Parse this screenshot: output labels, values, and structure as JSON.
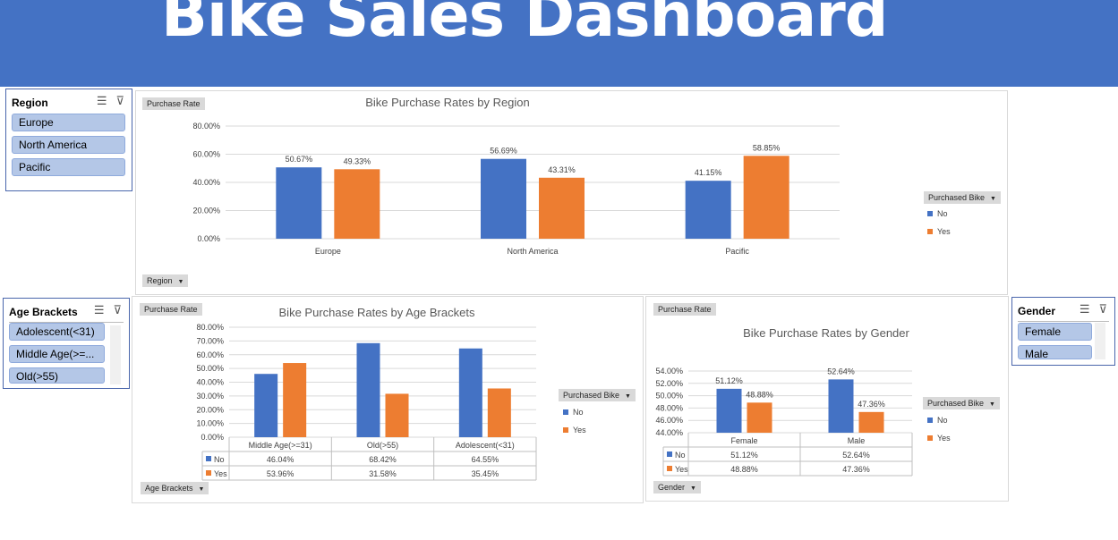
{
  "banner": {
    "title": "Bike Sales Dashboard"
  },
  "slicers": {
    "region": {
      "title": "Region",
      "items": [
        "Europe",
        "North America",
        "Pacific"
      ]
    },
    "age": {
      "title": "Age Brackets",
      "items": [
        "Adolescent(<31)",
        "Middle Age(>=...",
        "Old(>55)"
      ]
    },
    "gender": {
      "title": "Gender",
      "items": [
        "Female",
        "Male"
      ]
    }
  },
  "icons": {
    "multi_select": "multi-select-icon",
    "clear_filter": "clear-filter-icon",
    "dropdown": "dropdown-arrow-icon"
  },
  "field_buttons": {
    "purchase_rate": "Purchase Rate",
    "purchased_bike": "Purchased Bike",
    "region": "Region",
    "age_brackets": "Age Brackets",
    "gender": "Gender"
  },
  "colors": {
    "no": "#4472c4",
    "yes": "#ed7d31",
    "banner": "#4472c4",
    "slicer_item": "#b4c7e7"
  },
  "chart_data": [
    {
      "type": "bar",
      "title": "Bike Purchase Rates by Region",
      "categories": [
        "Europe",
        "North America",
        "Pacific"
      ],
      "series": [
        {
          "name": "No",
          "values": [
            50.67,
            56.69,
            41.15
          ]
        },
        {
          "name": "Yes",
          "values": [
            49.33,
            43.31,
            58.85
          ]
        }
      ],
      "data_labels": [
        [
          "50.67%",
          "56.69%",
          "41.15%"
        ],
        [
          "49.33%",
          "43.31%",
          "58.85%"
        ]
      ],
      "yticks": [
        "0.00%",
        "20.00%",
        "40.00%",
        "60.00%",
        "80.00%"
      ],
      "ylim": [
        0,
        80
      ],
      "grid": true,
      "legend": "right"
    },
    {
      "type": "bar",
      "title": "Bike Purchase Rates by Age Brackets",
      "categories": [
        "Middle Age(>=31)",
        "Old(>55)",
        "Adolescent(<31)"
      ],
      "series": [
        {
          "name": "No",
          "values": [
            46.04,
            68.42,
            64.55
          ]
        },
        {
          "name": "Yes",
          "values": [
            53.96,
            31.58,
            35.45
          ]
        }
      ],
      "table_values": [
        [
          "46.04%",
          "68.42%",
          "64.55%"
        ],
        [
          "53.96%",
          "31.58%",
          "35.45%"
        ]
      ],
      "yticks": [
        "0.00%",
        "10.00%",
        "20.00%",
        "30.00%",
        "40.00%",
        "50.00%",
        "60.00%",
        "70.00%",
        "80.00%"
      ],
      "ylim": [
        0,
        80
      ],
      "grid": true,
      "legend": "right"
    },
    {
      "type": "bar",
      "title": "Bike Purchase Rates by Gender",
      "categories": [
        "Female",
        "Male"
      ],
      "series": [
        {
          "name": "No",
          "values": [
            51.12,
            52.64
          ]
        },
        {
          "name": "Yes",
          "values": [
            48.88,
            47.36
          ]
        }
      ],
      "data_labels": [
        [
          "51.12%",
          "52.64%"
        ],
        [
          "48.88%",
          "47.36%"
        ]
      ],
      "table_values": [
        [
          "51.12%",
          "52.64%"
        ],
        [
          "48.88%",
          "47.36%"
        ]
      ],
      "yticks": [
        "44.00%",
        "46.00%",
        "48.00%",
        "50.00%",
        "52.00%",
        "54.00%"
      ],
      "ylim": [
        44,
        54
      ],
      "grid": true,
      "legend": "right"
    }
  ]
}
